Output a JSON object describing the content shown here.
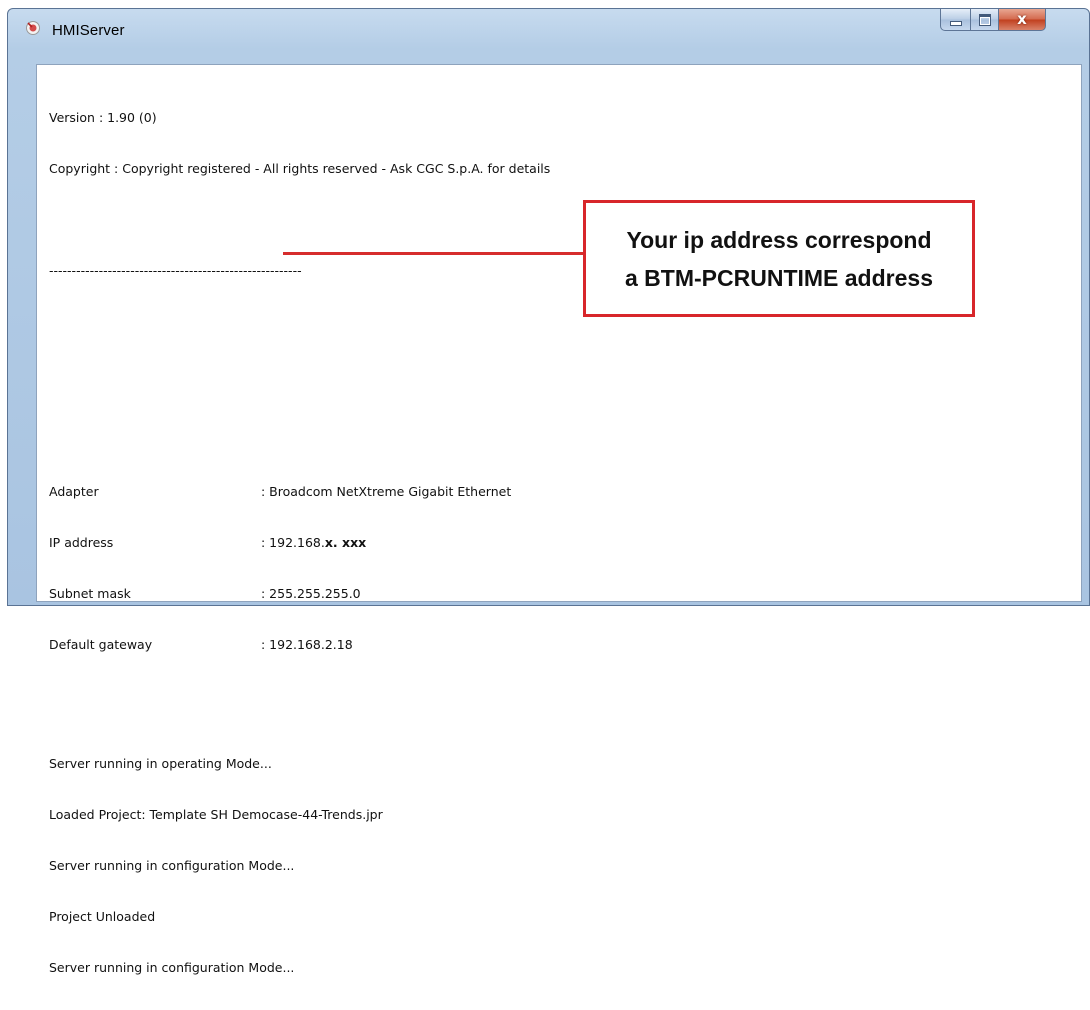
{
  "window": {
    "title": "HMIServer",
    "icon": "hmi-app-icon",
    "controls": {
      "minimize_icon": "minimize-icon",
      "maximize_icon": "maximize-icon",
      "close_glyph": "x"
    }
  },
  "log": {
    "version": "Version : 1.90 (0)",
    "copyright": "Copyright : Copyright registered - All rights reserved - Ask CGC S.p.A. for details",
    "separator": "--------------------------------------------------------",
    "network": [
      {
        "label": "Adapter",
        "value": ": Broadcom NetXtreme Gigabit Ethernet"
      },
      {
        "label": "IP address",
        "value": ": 192.168.",
        "value_hidden": "x. xxx"
      },
      {
        "label": "Subnet mask",
        "value": ": 255.255.255.0"
      },
      {
        "label": "Default gateway",
        "value": ": 192.168.2.18"
      }
    ],
    "messages": [
      "Server running in operating Mode...",
      "Loaded Project: Template SH Democase-44-Trends.jpr",
      "Server running in configuration Mode...",
      "Project Unloaded",
      "Server running in configuration Mode..."
    ]
  },
  "annotation": {
    "line1": "Your ip address correspond",
    "line2": "a BTM-PCRUNTIME address",
    "color": "#d8262a"
  }
}
